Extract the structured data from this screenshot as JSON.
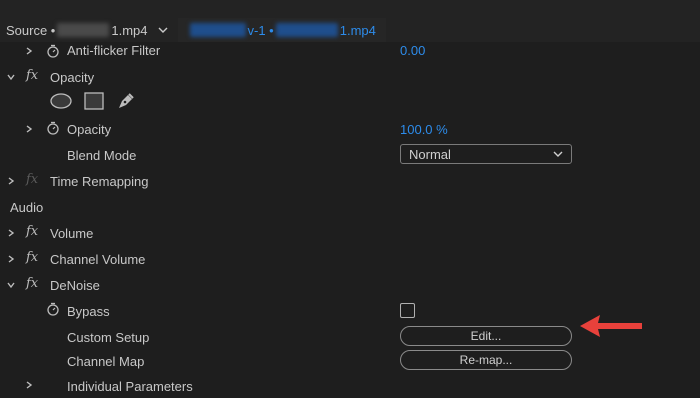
{
  "tabs": {
    "source_prefix": "Source •",
    "source_suffix": "1.mp4",
    "seq_mid": "v-1 •",
    "seq_suffix": "1.mp4"
  },
  "video": {
    "antiflicker": {
      "label": "Anti-flicker Filter",
      "value": "0.00"
    },
    "opacity_group": {
      "label": "Opacity"
    },
    "opacity": {
      "label": "Opacity",
      "value": "100.0 %"
    },
    "blend_mode": {
      "label": "Blend Mode",
      "value": "Normal"
    },
    "time_remapping": {
      "label": "Time Remapping"
    }
  },
  "audio": {
    "section_label": "Audio",
    "volume": {
      "label": "Volume"
    },
    "channel_volume": {
      "label": "Channel Volume"
    },
    "denoise": {
      "label": "DeNoise",
      "bypass": {
        "label": "Bypass",
        "checked": false
      },
      "custom_setup": {
        "label": "Custom Setup",
        "button": "Edit..."
      },
      "channel_map": {
        "label": "Channel Map",
        "button": "Re-map..."
      },
      "individual_parameters": {
        "label": "Individual Parameters"
      }
    }
  },
  "fx_glyph": "fx",
  "colors": {
    "accent": "#2d8ceb",
    "arrow": "#e8413b"
  }
}
